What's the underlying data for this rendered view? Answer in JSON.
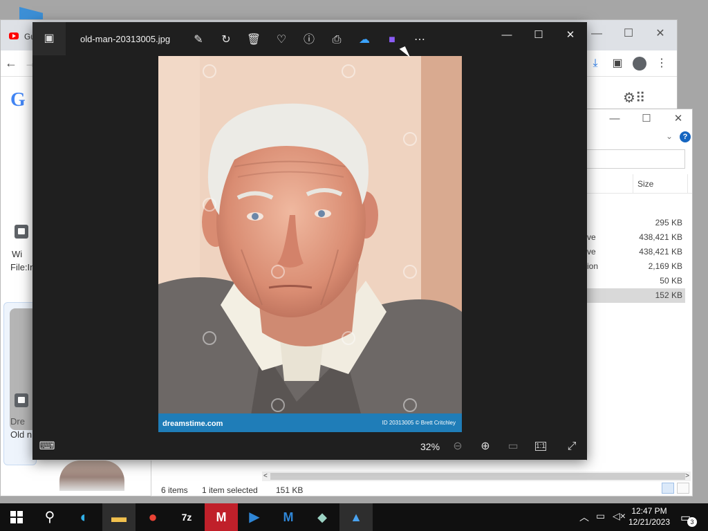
{
  "chrome": {
    "tab_title": "Gu",
    "left_texts": [
      "Wi",
      "File:In",
      "Dre",
      "Old n"
    ]
  },
  "explorer": {
    "size_header": "Size",
    "rows": [
      {
        "type": "",
        "size": "295 KB"
      },
      {
        "type": "ve",
        "size": "438,421 KB"
      },
      {
        "type": "ve",
        "size": "438,421 KB"
      },
      {
        "type": "ion",
        "size": "2,169 KB"
      },
      {
        "type": "",
        "size": "50 KB"
      },
      {
        "type": "",
        "size": "152 KB",
        "selected": true
      }
    ],
    "status": {
      "items": "6 items",
      "selected": "1 item selected",
      "size": "151 KB"
    }
  },
  "viewer": {
    "filename": "old-man-20313005.jpg",
    "zoom": "32%",
    "toolbar_icons": [
      "edit-icon",
      "rotate-icon",
      "delete-icon",
      "favorite-icon",
      "info-icon",
      "print-icon",
      "onedrive-icon",
      "clipchamp-icon",
      "more-icon"
    ],
    "photo": {
      "footer_brand": "dreamstime.com",
      "footer_credit": "ID 20313005 © Brett Critchley"
    }
  },
  "taskbar": {
    "time": "12:47 PM",
    "date": "12/21/2023",
    "notification_count": "3",
    "pinned": [
      "start",
      "search",
      "edge",
      "file-explorer",
      "chrome",
      "7zip",
      "app-m-red",
      "clipchamp",
      "app-m-blue",
      "app-glass",
      "app-photos"
    ]
  },
  "colors": {
    "viewer_bg": "#1f1f1f",
    "taskbar_bg": "#101010",
    "accent": "#1a73e8",
    "photo_footer": "#1f7db8"
  }
}
